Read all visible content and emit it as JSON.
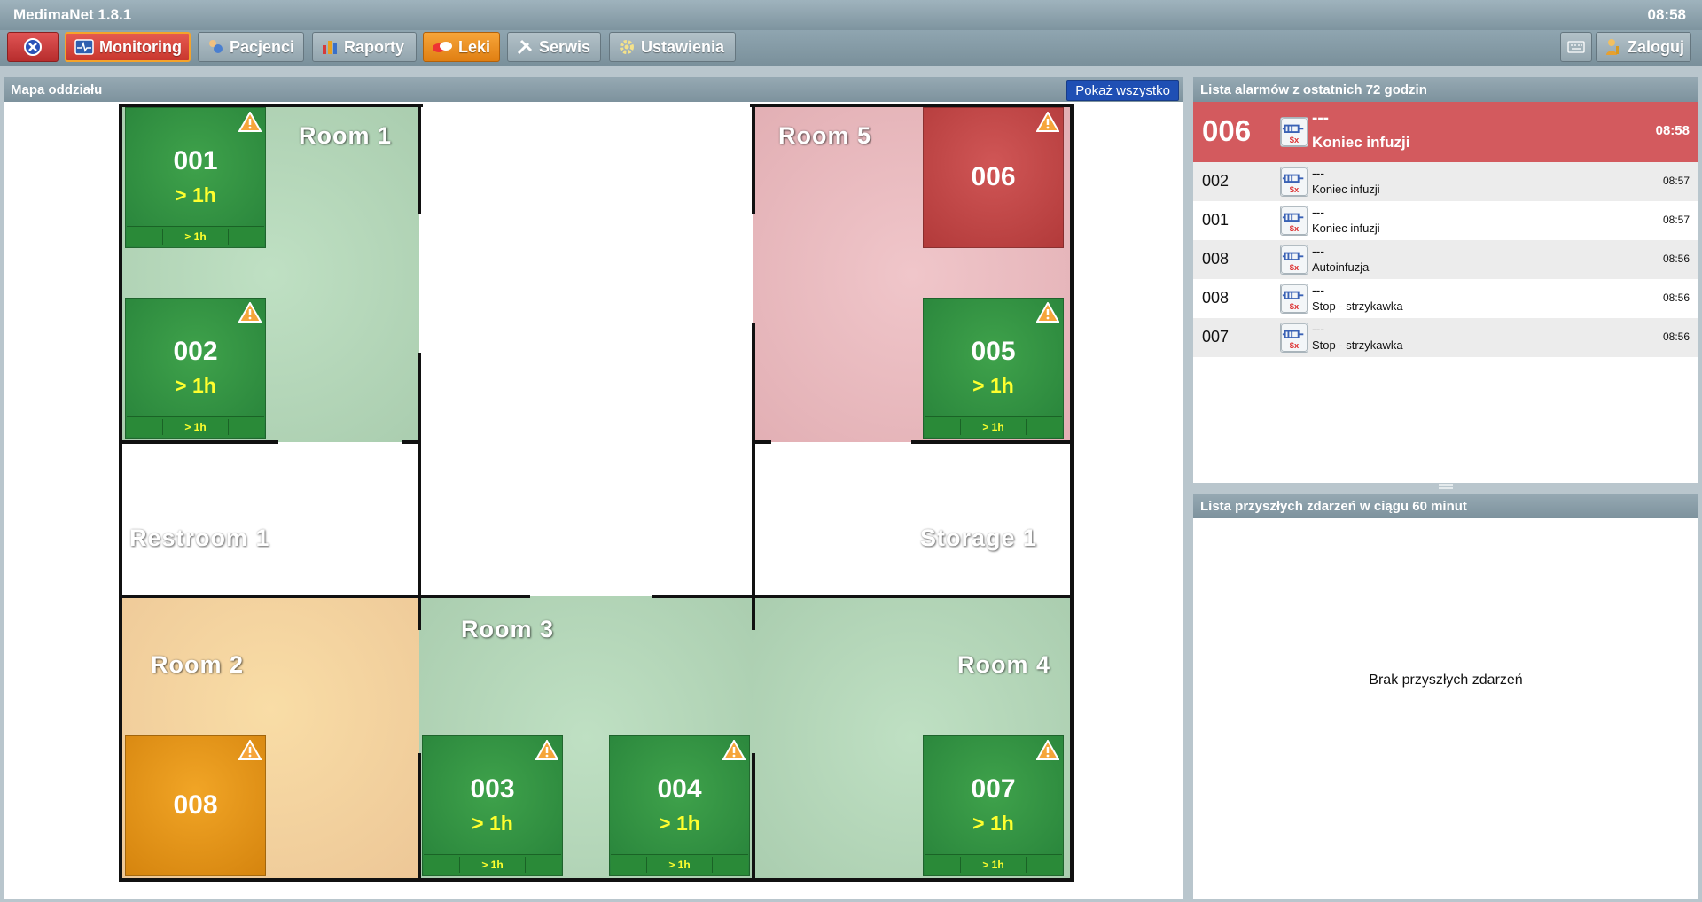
{
  "app": {
    "title": "MedimaNet 1.8.1",
    "clock": "08:58"
  },
  "toolbar": {
    "monitoring": "Monitoring",
    "patients": "Pacjenci",
    "reports": "Raporty",
    "drugs": "Leki",
    "service": "Serwis",
    "settings": "Ustawienia",
    "login": "Zaloguj"
  },
  "map": {
    "title": "Mapa oddziału",
    "show_all": "Pokaż wszystko",
    "rooms": {
      "room1": "Room 1",
      "room2": "Room 2",
      "room3": "Room 3",
      "room4": "Room 4",
      "room5": "Room 5",
      "restroom1": "Restroom 1",
      "storage1": "Storage 1"
    },
    "beds": {
      "b001": {
        "number": "001",
        "time": "> 1h",
        "bar": "> 1h",
        "color": "#2e8f3f"
      },
      "b002": {
        "number": "002",
        "time": "> 1h",
        "bar": "> 1h",
        "color": "#2e8f3f"
      },
      "b003": {
        "number": "003",
        "time": "> 1h",
        "bar": "> 1h",
        "color": "#2e8f3f"
      },
      "b004": {
        "number": "004",
        "time": "> 1h",
        "bar": "> 1h",
        "color": "#2e8f3f"
      },
      "b005": {
        "number": "005",
        "time": "> 1h",
        "bar": "> 1h",
        "color": "#2e8f3f"
      },
      "b006": {
        "number": "006",
        "color": "#c04545"
      },
      "b007": {
        "number": "007",
        "time": "> 1h",
        "bar": "> 1h",
        "color": "#2e8f3f"
      },
      "b008": {
        "number": "008",
        "color": "#e2921a"
      }
    }
  },
  "alarms": {
    "title": "Lista alarmów z ostatnich 72 godzin",
    "items": [
      {
        "bed": "006",
        "line1": "---",
        "line2": "Koniec infuzji",
        "time": "08:58",
        "icon": "syringe-pump-icon"
      },
      {
        "bed": "002",
        "line1": "---",
        "line2": "Koniec infuzji",
        "time": "08:57",
        "icon": "syringe-pump-icon"
      },
      {
        "bed": "001",
        "line1": "---",
        "line2": "Koniec infuzji",
        "time": "08:57",
        "icon": "syringe-pump-icon"
      },
      {
        "bed": "008",
        "line1": "---",
        "line2": "Autoinfuzja",
        "time": "08:56",
        "icon": "syringe-pump-icon"
      },
      {
        "bed": "008",
        "line1": "---",
        "line2": "Stop - strzykawka",
        "time": "08:56",
        "icon": "syringe-pump-icon"
      },
      {
        "bed": "007",
        "line1": "---",
        "line2": "Stop - strzykawka",
        "time": "08:56",
        "icon": "syringe-pump-icon"
      }
    ]
  },
  "events": {
    "title": "Lista przyszłych zdarzeń w ciągu 60 minut",
    "empty": "Brak przyszłych zdarzeń"
  }
}
